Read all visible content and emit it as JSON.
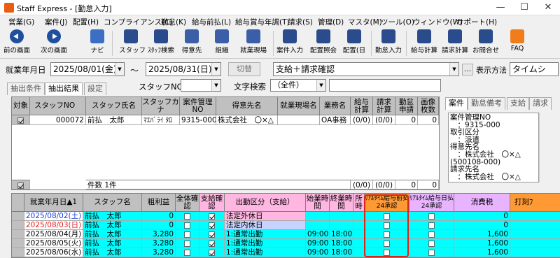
{
  "app": {
    "title": "Staff Express - [勤怠入力]"
  },
  "window_buttons": [
    "—",
    "☐",
    "✕"
  ],
  "menu": [
    "営業(G)",
    "案件(J)",
    "配置(H)",
    "コンプライアンス(C)",
    "勤怠(K)",
    "給与前払(L)",
    "給与賞与年調(T)",
    "請求(S)",
    "管理(D)",
    "マスタ(M)",
    "ツール(O)",
    "ウィンドウ(W)",
    "サポート(H)"
  ],
  "toolbar": {
    "prev": "前の画面",
    "next": "次の画面",
    "navi": "ナビ",
    "staff": "スタッフ",
    "staff_search": "ｽﾀｯﾌ検索",
    "client": "得意先",
    "org": "組織",
    "site": "就業現場",
    "case_input": "案件入力",
    "assign_inquiry": "配置照会",
    "assign": "配置(日",
    "attendance_input": "勤怠入力",
    "payroll_calc": "給与計算",
    "billing_calc": "請求計算",
    "contact": "お問合せ",
    "faq": "FAQ"
  },
  "filter": {
    "period_label": "就業年月日",
    "date_from": "2025/08/01(金)",
    "tilde": "～",
    "date_to": "2025/08/31(日)",
    "switch_button": "切替",
    "mode_value": "支給＋請求確認",
    "ellipsis": "...",
    "display_label": "表示方法",
    "display_value": "タイムシ"
  },
  "tabs": [
    "抽出条件",
    "抽出結果",
    "設定"
  ],
  "search": {
    "staff_no_label": "スタッフNO",
    "text_search_label": "文字検索",
    "text_search_value": "（全件）"
  },
  "upper_grid": {
    "headers": [
      "対象",
      "スタッフNO",
      "スタッフ氏名",
      "スタッフカナ",
      "案件管理NO",
      "得意先名",
      "就業現場名",
      "業務名",
      "給与計算",
      "請求計算",
      "勤怠申請",
      "画像枚数"
    ],
    "row": {
      "staff_no": "000072",
      "name": "前払　太郎",
      "kana": "ﾏｴﾊﾞﾗｲ ﾀﾛ",
      "case_no": "9315-000",
      "client": "株式会社　〇×△",
      "site": "",
      "job": "OA事務",
      "pay": "(0/0)",
      "bill": "(0/0)",
      "apply": "0",
      "images": "0"
    },
    "footer": {
      "count": "件数 1件",
      "pay": "(0/0)",
      "bill": "(0/0)",
      "apply": "0",
      "images": "0"
    }
  },
  "side_tabs": [
    "案件",
    "勤怠備考",
    "支給",
    "請求"
  ],
  "side_text": "案件管理NO\n　：9315-000\n取引区分\n　：派遣\n得意先名\n　：株式会社　〇×△\n(500108-000)\n請求先名\n　：株式会社　〇×△",
  "lower_grid": {
    "headers": {
      "date": "就業年月日▲1",
      "staff": "スタッフ名",
      "profit": "粗利益",
      "all_confirm": "全体確認",
      "pay_confirm": "支給確認",
      "attend_type": "出勤区分（支給）",
      "start": "始業時間",
      "end": "終業時間",
      "break": "所時",
      "realtime_pay": "ﾘｱﾙﾀｲﾑ給与前払24承認",
      "realtime_day": "ﾘｱﾙﾀｲﾑ給与日払24承認",
      "tax": "消費税",
      "clock": "打刻ﾌ"
    },
    "rows": [
      {
        "date": "2025/08/02(土)",
        "date_color": "#1a3fd6",
        "staff": "前払　太郎",
        "profit": "0",
        "all": false,
        "pay": true,
        "type": "法定外休日",
        "type_bg": "#ffb6e1",
        "start": "",
        "end": "",
        "rt_pay": false,
        "rt_day": false,
        "tax": "0"
      },
      {
        "date": "2025/08/03(日)",
        "date_color": "#e02020",
        "staff": "前払　太郎",
        "profit": "0",
        "all": false,
        "pay": true,
        "type": "法定内休日",
        "type_bg": "#c7d3ff",
        "start": "",
        "end": "",
        "rt_pay": false,
        "rt_day": false,
        "tax": "0"
      },
      {
        "date": "2025/08/04(月)",
        "date_color": "#000000",
        "staff": "前払　太郎",
        "profit": "3,280",
        "all": false,
        "pay": true,
        "type": "1:通常出勤",
        "type_bg": "#00ffff",
        "start": "09:00",
        "end": "18:00",
        "rt_pay": false,
        "rt_day": false,
        "tax": "1,600"
      },
      {
        "date": "2025/08/05(火)",
        "date_color": "#000000",
        "staff": "前払　太郎",
        "profit": "3,280",
        "all": false,
        "pay": true,
        "type": "1:通常出勤",
        "type_bg": "#00ffff",
        "start": "09:00",
        "end": "18:00",
        "rt_pay": false,
        "rt_day": false,
        "tax": "1,600"
      },
      {
        "date": "2025/08/06(水)",
        "date_color": "#000000",
        "staff": "前払　太郎",
        "profit": "3,280",
        "all": false,
        "pay": true,
        "type": "1:通常出勤",
        "type_bg": "#00ffff",
        "start": "09:00",
        "end": "18:00",
        "rt_pay": false,
        "rt_day": false,
        "tax": "1,600"
      }
    ]
  },
  "colors": {
    "accent_orange": "#ff9933",
    "highlight_red": "#d9261c",
    "row_cyan": "#00ffff",
    "header_pink": "#ffb6e1",
    "header_purple": "#e8b4ff"
  }
}
